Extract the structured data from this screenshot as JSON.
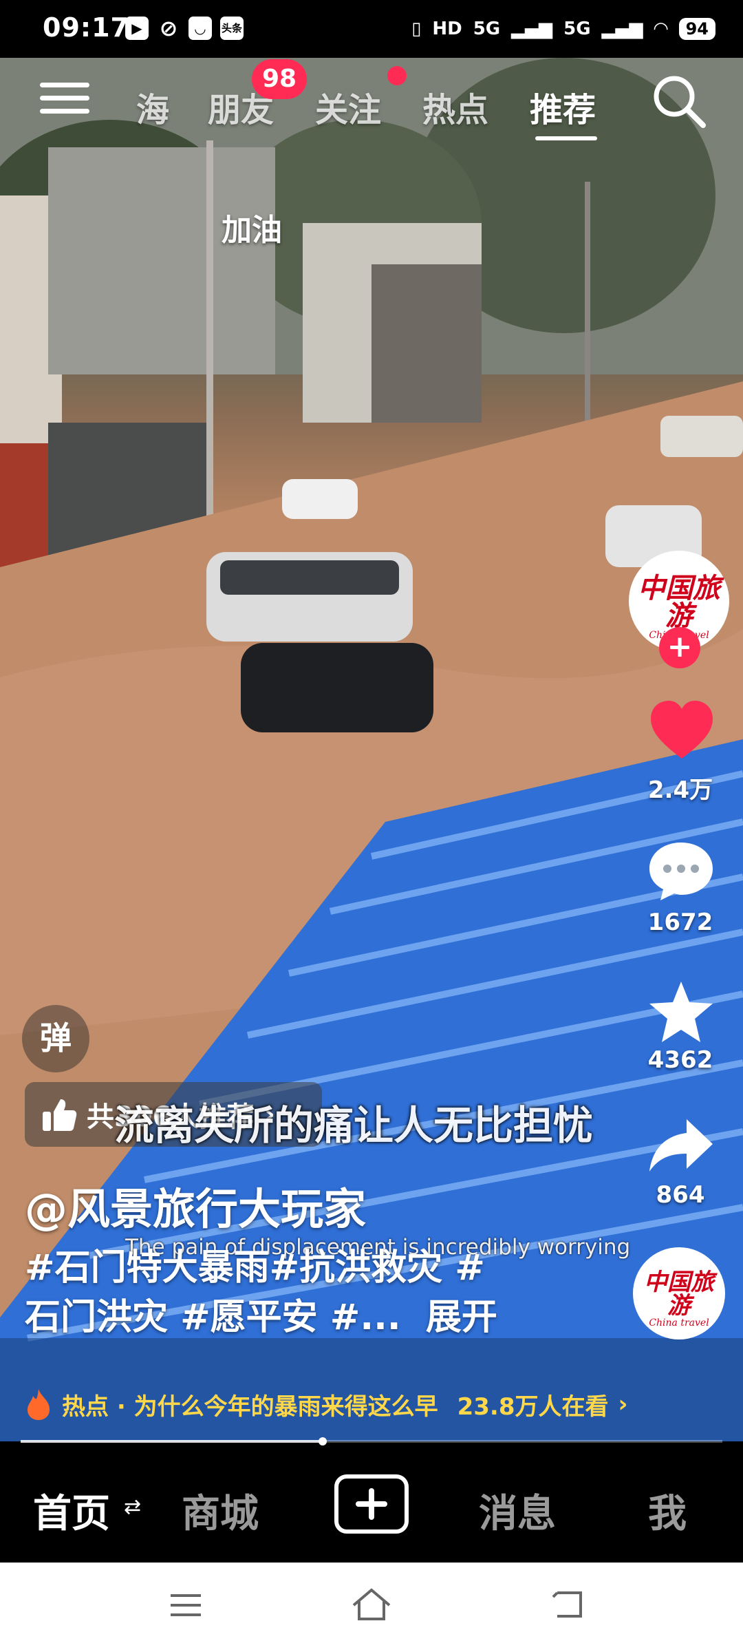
{
  "status_bar": {
    "time": "09:17",
    "app_icons": [
      "play-icon",
      "leaf-app-icon",
      "message-icon",
      "toutiao-icon"
    ],
    "toutiao_label": "头条",
    "network": [
      "HD",
      "5G",
      "5G"
    ],
    "battery": "94"
  },
  "top_nav": {
    "tabs": [
      "海",
      "朋友",
      "关注",
      "热点",
      "推荐"
    ],
    "active_tab": "推荐",
    "friends_badge": "98"
  },
  "video": {
    "overlay_text": "加油",
    "subtitle_cn": "流离失所的痛让人无比担忧",
    "subtitle_en": "The pain of displacement is incredibly worrying"
  },
  "actions": {
    "author_logo_cn": "中国旅游",
    "author_logo_en": "China travel",
    "likes": "2.4万",
    "comments": "1672",
    "favorites": "4362",
    "shares": "864"
  },
  "danmaku": {
    "label": "弹"
  },
  "recommend": {
    "label": "共306人推荐",
    "arrow": "›"
  },
  "post": {
    "author": "@风景旅行大玩家",
    "caption_line1": "#石门特大暴雨#抗洪救灾 #",
    "caption_line2": "石门洪灾 #愿平安 #...",
    "expand": "展开"
  },
  "hot_bar": {
    "text": "热点 · 为什么今年的暴雨来得这么早",
    "viewers": "23.8万人在看",
    "arrow": "›"
  },
  "progress": {
    "fraction": 0.43
  },
  "bottom_nav": {
    "tabs": [
      "首页",
      "商城",
      "消息",
      "我"
    ],
    "active": "首页",
    "switch_glyph": "⇄"
  },
  "colors": {
    "accent": "#fe2c55",
    "hot_text": "#ffd74a",
    "flood_water": "#c28f6c",
    "roof_blue": "#2f6fd6"
  }
}
